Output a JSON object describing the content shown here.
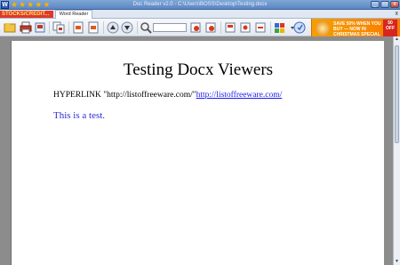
{
  "window": {
    "title": "Doc Reader v2.0 - C:\\Users\\BOSS\\Desktop\\Testing.docx",
    "minimize": "_",
    "maximize": "□",
    "close": "x",
    "star_glyph": "★"
  },
  "tabbar": {
    "ad_text": "STOCKS/CREDIT...",
    "tab_label": "Word Reader",
    "close_glyph": "x"
  },
  "toolbar": {
    "search_placeholder": "",
    "banner_text": "SAVE 50% WHEN YOU BUY — NOW IN CHRISTMAS SPECIAL",
    "banner_badge": "50 OFF"
  },
  "document": {
    "title": "Testing Docx Viewers",
    "hyperlink_prefix": "HYPERLINK \"http://listoffreeware.com/\"",
    "hyperlink_text": "http://listoffreeware.com/",
    "body_text": "This is a test."
  },
  "scrollbar": {
    "up": "▲",
    "down": "▼"
  }
}
